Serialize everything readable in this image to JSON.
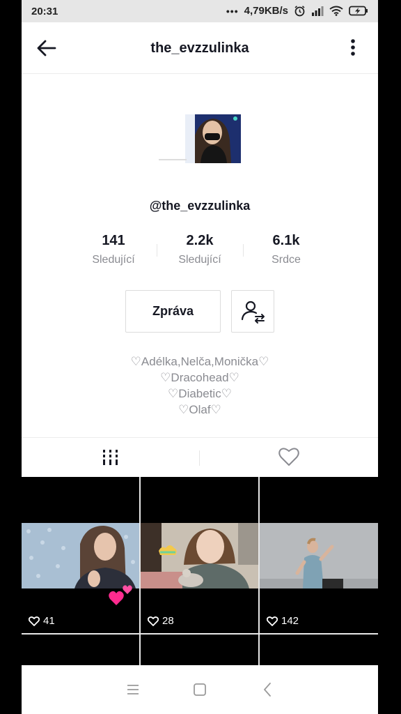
{
  "status_bar": {
    "time": "20:31",
    "dots": "•••",
    "speed": "4,79KB/s",
    "icons": [
      "alarm-icon",
      "signal-icon",
      "wifi-icon",
      "battery-charging-icon"
    ]
  },
  "header": {
    "title": "the_evzzulinka",
    "back_icon": "arrow-left-icon",
    "more_icon": "more-vertical-icon"
  },
  "profile": {
    "handle": "@the_evzzulinka",
    "stats": [
      {
        "value": "141",
        "label": "Sledující"
      },
      {
        "value": "2.2k",
        "label": "Sledující"
      },
      {
        "value": "6.1k",
        "label": "Srdce"
      }
    ],
    "message_label": "Zpráva",
    "follow_icon": "user-swap-icon",
    "bio": [
      "♡Adélka,Nelča,Monička♡",
      "♡Dracohead♡",
      "♡Diabetic♡",
      "♡Olaf♡"
    ]
  },
  "tabs": [
    {
      "icon": "grid-icon",
      "active": true
    },
    {
      "icon": "heart-outline-icon",
      "active": false
    }
  ],
  "videos": [
    {
      "likes": "41"
    },
    {
      "likes": "28"
    },
    {
      "likes": "142"
    }
  ],
  "nav_bar": {
    "icons": [
      "menu-icon",
      "home-square-icon",
      "back-chevron-icon"
    ]
  },
  "colors": {
    "text_primary": "#161823",
    "text_secondary": "#8a8b91",
    "border": "#dcdcdc"
  }
}
